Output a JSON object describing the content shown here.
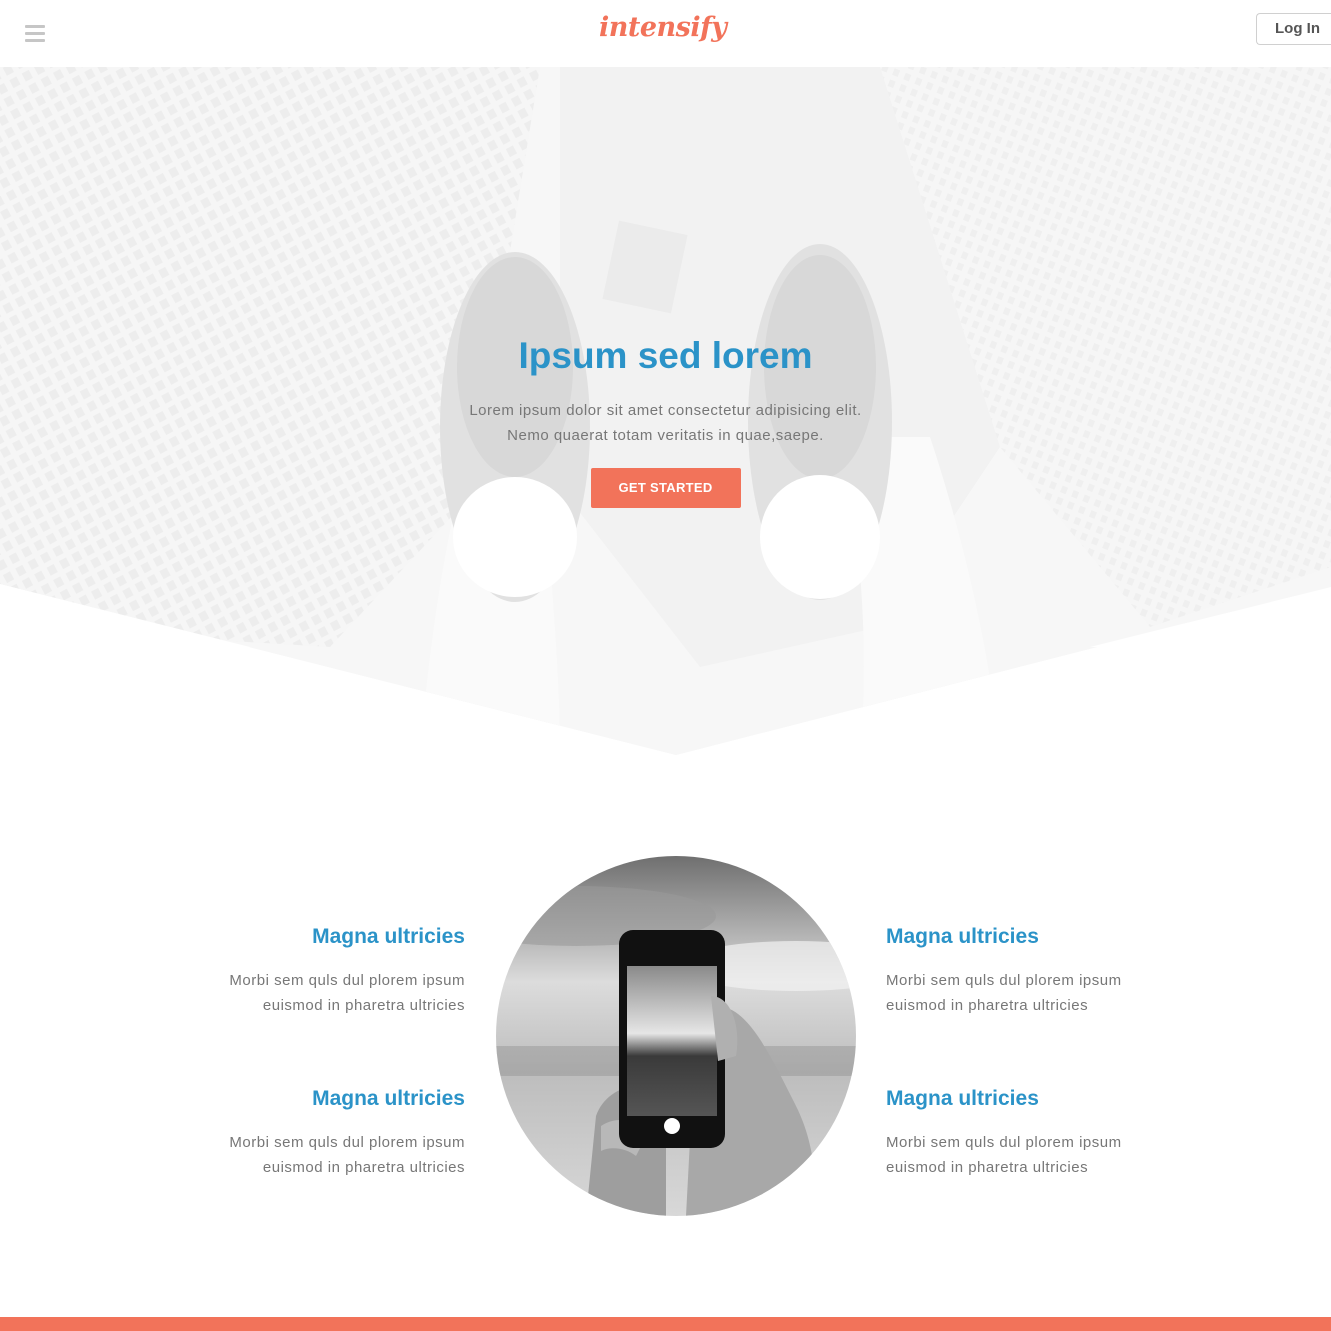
{
  "header": {
    "logo_text": "intensify",
    "login_label": "Log In",
    "menu_icon": "hamburger-menu-icon"
  },
  "hero": {
    "title": "Ipsum sed lorem",
    "line1": "Lorem ipsum dolor sit amet consectetur adipisicing elit.",
    "line2": "Nemo quaerat totam veritatis in quae,saepe.",
    "button_label": "GET STARTED"
  },
  "features": [
    {
      "title": "Magna ultricies",
      "line1": "Morbi sem quls dul plorem ipsum",
      "line2": "euismod in pharetra ultricies"
    },
    {
      "title": "Magna ultricies",
      "line1": "Morbi sem quls dul plorem ipsum",
      "line2": "euismod in pharetra ultricies"
    },
    {
      "title": "Magna ultricies",
      "line1": "Morbi sem quls dul plorem ipsum",
      "line2": "euismod in pharetra ultricies"
    },
    {
      "title": "Magna ultricies",
      "line1": "Morbi sem quls dul plorem ipsum",
      "line2": "euismod in pharetra ultricies"
    }
  ],
  "colors": {
    "accent": "#f2735a",
    "heading_blue": "#2b93c8",
    "body_text": "#777777"
  }
}
